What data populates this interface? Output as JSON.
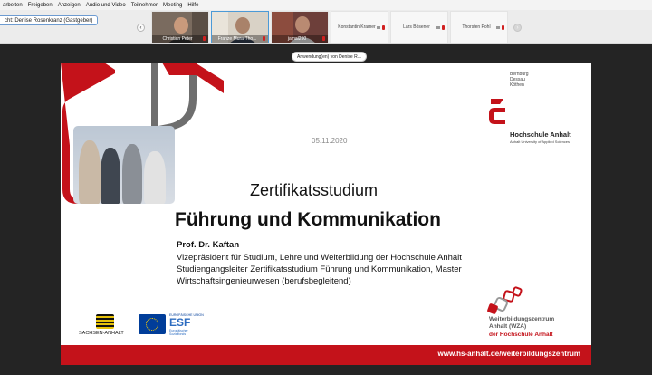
{
  "menu": [
    "arbeiten",
    "Freigeben",
    "Anzeigen",
    "Audio und Video",
    "Teilnehmer",
    "Meeting",
    "Hilfe"
  ],
  "speaker_label": "cht: Denise Rosenkranz (Gastgeber)",
  "share_pill": "Anwendung(en) von Denise R...",
  "participants": [
    {
      "name": "Christian Peter",
      "video": true,
      "active": false
    },
    {
      "name": "Franze Mura-Tho...",
      "video": true,
      "active": true
    },
    {
      "name": "jamal250",
      "video": true,
      "active": false
    },
    {
      "name": "Konstantin Kramer",
      "video": false,
      "active": false
    },
    {
      "name": "Lars Bösener",
      "video": false,
      "active": false
    },
    {
      "name": "Thorsten Pohl",
      "video": false,
      "active": false
    }
  ],
  "nav": {
    "prev": "‹",
    "next": "›"
  },
  "slide": {
    "date": "05.11.2020",
    "logo_cities": [
      "Bernburg",
      "Dessau",
      "Köthen"
    ],
    "logo_name": "Hochschule Anhalt",
    "logo_sub": "Anhalt University of Applied Sciences",
    "title_small": "Zertifikatsstudium",
    "title_big": "Führung und Kommunikation",
    "prof": "Prof. Dr. Kaftan",
    "info_lines": [
      "Vizepräsident für Studium, Lehre und Weiterbildung der Hochschule Anhalt",
      "Studiengangsleiter Zertifikatsstudium Führung und Kommunikation, Master",
      "Wirtschaftsingenieurwesen (berufsbegleitend)"
    ],
    "sachsen": "SACHSEN-ANHALT",
    "esf_top": "EUROPÄISCHE UNION",
    "esf_name": "ESF",
    "esf_sub": [
      "Europäischer",
      "Sozialfonds"
    ],
    "wzb": [
      "Weiterbildungszentrum",
      "Anhalt (WZA)",
      "der Hochschule Anhalt"
    ],
    "footer_url": "www.hs-anhalt.de/weiterbildungszentrum"
  },
  "colors": {
    "accent_red": "#c4121a",
    "stage": "#242424",
    "active_border": "#4c9ad6"
  }
}
